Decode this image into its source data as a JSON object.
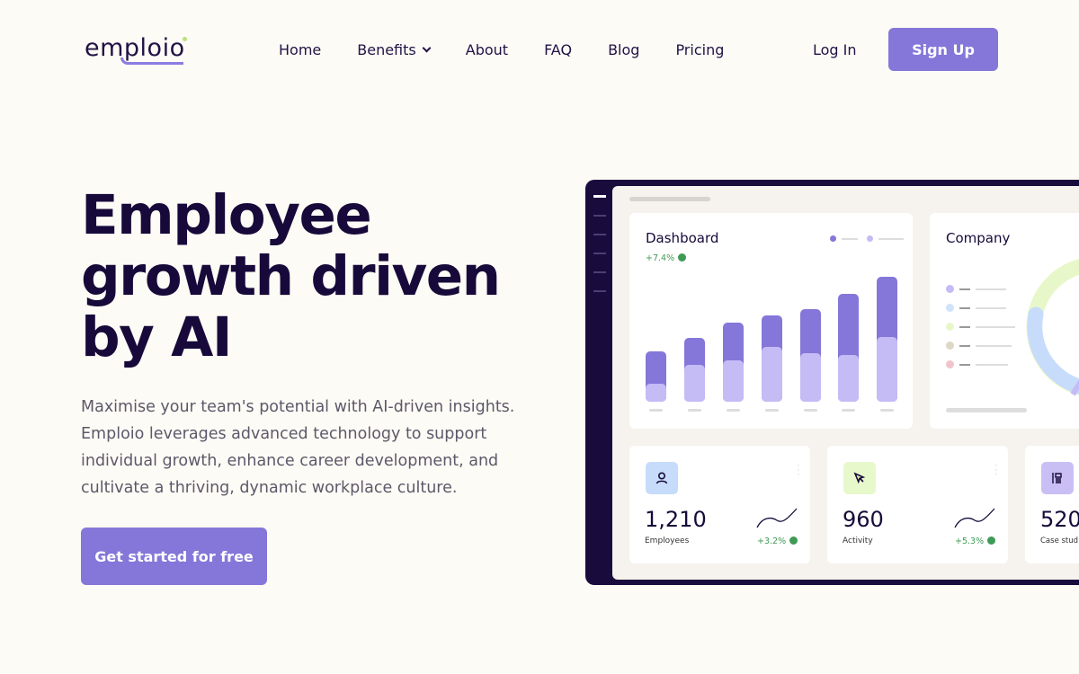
{
  "brand": {
    "name": "emploio"
  },
  "nav": {
    "items": [
      "Home",
      "Benefits",
      "About",
      "FAQ",
      "Blog",
      "Pricing"
    ],
    "login": "Log In",
    "signup": "Sign Up"
  },
  "hero": {
    "title": "Employee growth driven by AI",
    "description": "Maximise your team's potential with AI-driven insights. Emploio leverages advanced technology to support individual growth, enhance career development, and cultivate a thriving, dynamic workplace culture.",
    "cta": "Get started for free"
  },
  "dashboard": {
    "title": "Dashboard",
    "change": "+7.4%",
    "colors": {
      "primary": "#8477d9",
      "secondary": "#c5bbf5"
    },
    "bars": [
      {
        "total": 56,
        "part": 20
      },
      {
        "total": 71,
        "part": 41
      },
      {
        "total": 88,
        "part": 46
      },
      {
        "total": 96,
        "part": 61
      },
      {
        "total": 103,
        "part": 54
      },
      {
        "total": 120,
        "part": 52
      },
      {
        "total": 139,
        "part": 72
      }
    ]
  },
  "company": {
    "title": "Company",
    "legend_colors": [
      "#c5bbf5",
      "#cfe3fb",
      "#e8f7c9",
      "#ddd8c5",
      "#f1c3cb"
    ]
  },
  "stats": [
    {
      "value": "1,210",
      "label": "Employees",
      "change": "+3.2%",
      "icon": "user-icon",
      "color": "#c7dcfb"
    },
    {
      "value": "960",
      "label": "Activity",
      "change": "+5.3%",
      "icon": "cursor-icon",
      "color": "#e7f8cb"
    },
    {
      "value": "520",
      "label": "Case stud",
      "icon": "document-icon",
      "color": "#c9bff5"
    }
  ]
}
